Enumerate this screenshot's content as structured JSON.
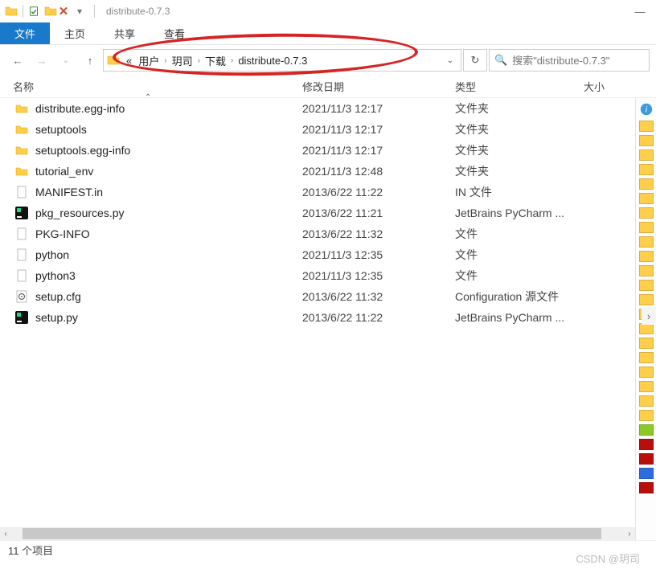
{
  "title": "distribute-0.7.3",
  "ribbon": {
    "file_tab": "文件",
    "tabs": [
      "主页",
      "共享",
      "查看"
    ]
  },
  "breadcrumbs": {
    "prefix": "«",
    "items": [
      "用户",
      "玥司",
      "下载",
      "distribute-0.7.3"
    ]
  },
  "search": {
    "placeholder": "搜索\"distribute-0.7.3\""
  },
  "columns": {
    "name": "名称",
    "date": "修改日期",
    "type": "类型",
    "size": "大小"
  },
  "files": [
    {
      "icon": "folder",
      "name": "distribute.egg-info",
      "date": "2021/11/3 12:17",
      "type": "文件夹"
    },
    {
      "icon": "folder",
      "name": "setuptools",
      "date": "2021/11/3 12:17",
      "type": "文件夹"
    },
    {
      "icon": "folder",
      "name": "setuptools.egg-info",
      "date": "2021/11/3 12:17",
      "type": "文件夹"
    },
    {
      "icon": "folder",
      "name": "tutorial_env",
      "date": "2021/11/3 12:48",
      "type": "文件夹"
    },
    {
      "icon": "file",
      "name": "MANIFEST.in",
      "date": "2013/6/22 11:22",
      "type": "IN 文件"
    },
    {
      "icon": "pycharm",
      "name": "pkg_resources.py",
      "date": "2013/6/22 11:21",
      "type": "JetBrains PyCharm ..."
    },
    {
      "icon": "file",
      "name": "PKG-INFO",
      "date": "2013/6/22 11:32",
      "type": "文件"
    },
    {
      "icon": "file",
      "name": "python",
      "date": "2021/11/3 12:35",
      "type": "文件"
    },
    {
      "icon": "file",
      "name": "python3",
      "date": "2021/11/3 12:35",
      "type": "文件"
    },
    {
      "icon": "cfg",
      "name": "setup.cfg",
      "date": "2013/6/22 11:32",
      "type": "Configuration 源文件"
    },
    {
      "icon": "pycharm",
      "name": "setup.py",
      "date": "2013/6/22 11:22",
      "type": "JetBrains PyCharm ..."
    }
  ],
  "status": "11 个项目",
  "watermark": "CSDN @玥司"
}
